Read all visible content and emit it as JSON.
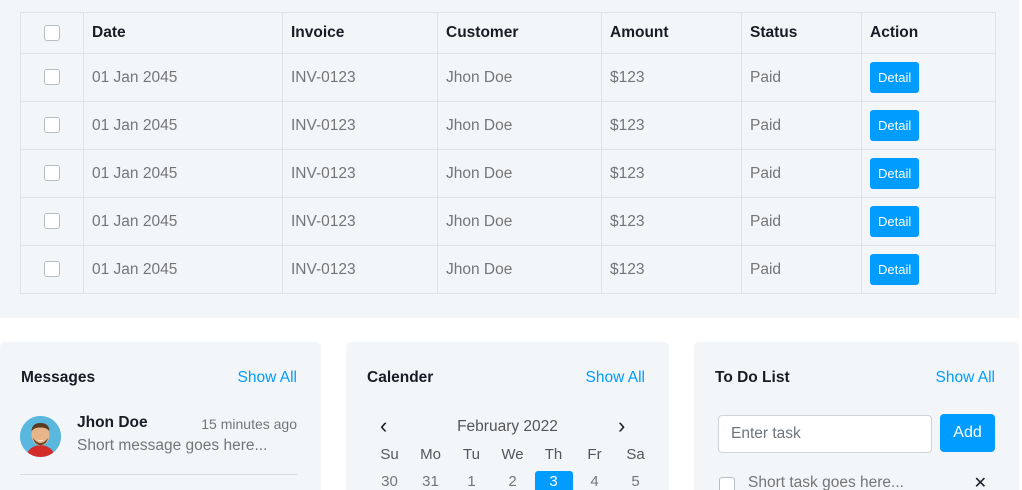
{
  "table": {
    "headers": [
      "Date",
      "Invoice",
      "Customer",
      "Amount",
      "Status",
      "Action"
    ],
    "rows": [
      {
        "date": "01 Jan 2045",
        "invoice": "INV-0123",
        "customer": "Jhon Doe",
        "amount": "$123",
        "status": "Paid",
        "action": "Detail"
      },
      {
        "date": "01 Jan 2045",
        "invoice": "INV-0123",
        "customer": "Jhon Doe",
        "amount": "$123",
        "status": "Paid",
        "action": "Detail"
      },
      {
        "date": "01 Jan 2045",
        "invoice": "INV-0123",
        "customer": "Jhon Doe",
        "amount": "$123",
        "status": "Paid",
        "action": "Detail"
      },
      {
        "date": "01 Jan 2045",
        "invoice": "INV-0123",
        "customer": "Jhon Doe",
        "amount": "$123",
        "status": "Paid",
        "action": "Detail"
      },
      {
        "date": "01 Jan 2045",
        "invoice": "INV-0123",
        "customer": "Jhon Doe",
        "amount": "$123",
        "status": "Paid",
        "action": "Detail"
      }
    ]
  },
  "messages": {
    "title": "Messages",
    "show_all": "Show All",
    "items": [
      {
        "name": "Jhon Doe",
        "time": "15 minutes ago",
        "text": "Short message goes here..."
      }
    ]
  },
  "calendar": {
    "title": "Calender",
    "show_all": "Show All",
    "month": "February 2022",
    "prev_icon": "chevron-left-icon",
    "next_icon": "chevron-right-icon",
    "weekdays": [
      "Su",
      "Mo",
      "Tu",
      "We",
      "Th",
      "Fr",
      "Sa"
    ],
    "days": [
      "30",
      "31",
      "1",
      "2",
      "3",
      "4",
      "5"
    ],
    "today": "3"
  },
  "todo": {
    "title": "To Do List",
    "show_all": "Show All",
    "placeholder": "Enter task",
    "add_label": "Add",
    "items": [
      {
        "text": "Short task goes here...",
        "done": false,
        "delete_icon": "close-icon"
      }
    ]
  },
  "colors": {
    "primary": "#009cff",
    "panel_bg": "#f3f6f9",
    "heading": "#191c24",
    "text": "#757575"
  }
}
